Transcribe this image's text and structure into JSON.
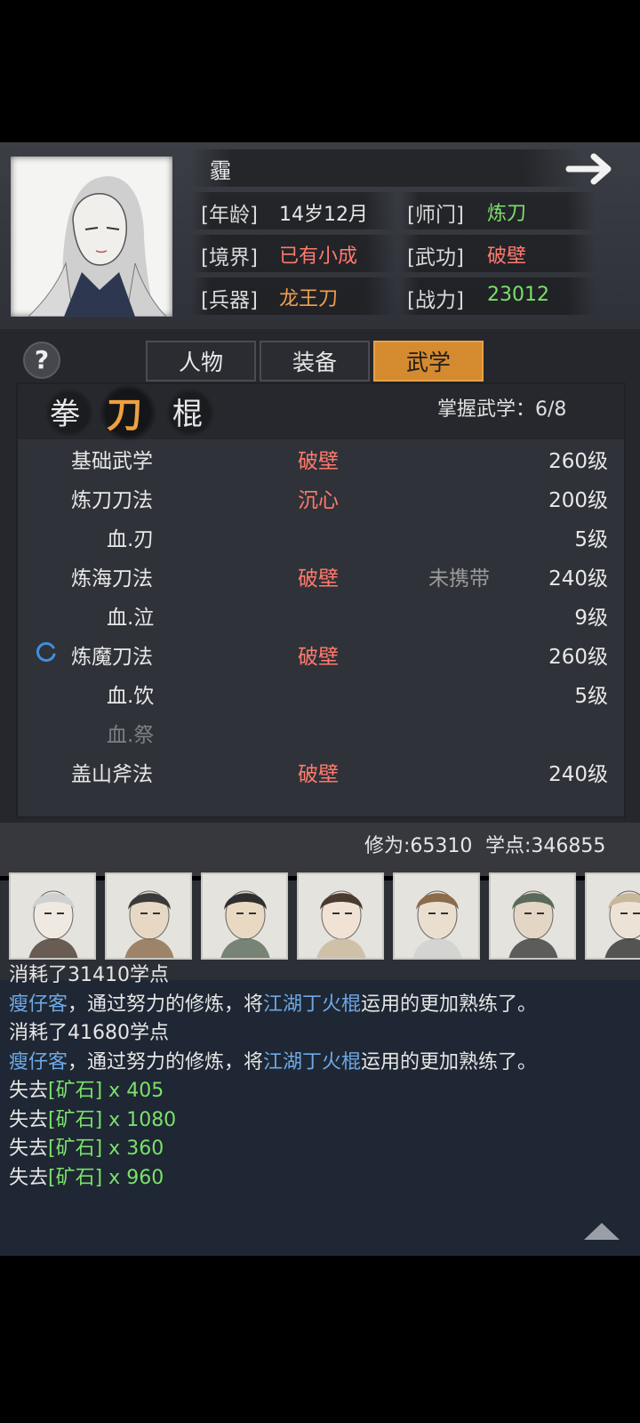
{
  "character": {
    "name": "霾",
    "age_label": "[年龄]",
    "age": "14岁12月",
    "sect_label": "[师门]",
    "sect": "炼刀",
    "realm_label": "[境界]",
    "realm": "已有小成",
    "skill_label": "[武功]",
    "skill": "破壁",
    "weapon_label": "[兵器]",
    "weapon": "龙王刀",
    "power_label": "[战力]",
    "power": "23012"
  },
  "help_glyph": "?",
  "tabs": [
    "人物",
    "装备",
    "武学"
  ],
  "active_tab": 2,
  "categories": [
    "拳",
    "刀",
    "棍"
  ],
  "active_category": 1,
  "mastery": "掌握武学：6/8",
  "skills": [
    {
      "name": "基础武学",
      "stage": "破壁",
      "carry": "",
      "level": "260级",
      "sub": false,
      "dim": false
    },
    {
      "name": "炼刀刀法",
      "stage": "沉心",
      "carry": "",
      "level": "200级",
      "sub": false,
      "dim": false
    },
    {
      "name": "血.刃",
      "stage": "",
      "carry": "",
      "level": "5级",
      "sub": true,
      "dim": false
    },
    {
      "name": "炼海刀法",
      "stage": "破壁",
      "carry": "未携带",
      "level": "240级",
      "sub": false,
      "dim": false
    },
    {
      "name": "血.泣",
      "stage": "",
      "carry": "",
      "level": "9级",
      "sub": true,
      "dim": false
    },
    {
      "name": "炼魔刀法",
      "stage": "破壁",
      "carry": "",
      "level": "260级",
      "sub": false,
      "dim": false
    },
    {
      "name": "血.饮",
      "stage": "",
      "carry": "",
      "level": "5级",
      "sub": true,
      "dim": false
    },
    {
      "name": "血.祭",
      "stage": "",
      "carry": "",
      "level": "",
      "sub": true,
      "dim": true
    },
    {
      "name": "盖山斧法",
      "stage": "破壁",
      "carry": "",
      "level": "240级",
      "sub": false,
      "dim": false
    }
  ],
  "stats": {
    "xiuwei": "修为:65310",
    "xuedian": "学点:346855"
  },
  "log": [
    [
      {
        "t": "消耗了31410学点",
        "c": "white"
      }
    ],
    [
      {
        "t": "瘦仔客",
        "c": "blue"
      },
      {
        "t": "，通过努力的修炼，将",
        "c": "white"
      },
      {
        "t": "江湖丁火棍",
        "c": "blue"
      },
      {
        "t": "运用的更加熟练了。",
        "c": "white"
      }
    ],
    [
      {
        "t": "消耗了41680学点",
        "c": "white"
      }
    ],
    [
      {
        "t": "瘦仔客",
        "c": "blue"
      },
      {
        "t": "，通过努力的修炼，将",
        "c": "white"
      },
      {
        "t": "江湖丁火棍",
        "c": "blue"
      },
      {
        "t": "运用的更加熟练了。",
        "c": "white"
      }
    ],
    [
      {
        "t": "失去",
        "c": "white"
      },
      {
        "t": "[矿石]",
        "c": "green"
      },
      {
        "t": " x 405",
        "c": "green"
      }
    ],
    [
      {
        "t": "失去",
        "c": "white"
      },
      {
        "t": "[矿石]",
        "c": "green"
      },
      {
        "t": " x 1080",
        "c": "green"
      }
    ],
    [
      {
        "t": "失去",
        "c": "white"
      },
      {
        "t": "[矿石]",
        "c": "green"
      },
      {
        "t": " x 360",
        "c": "green"
      }
    ],
    [
      {
        "t": "失去",
        "c": "white"
      },
      {
        "t": "[矿石]",
        "c": "green"
      },
      {
        "t": " x 960",
        "c": "green"
      }
    ]
  ],
  "icons": {
    "next": "arrow-right-icon",
    "help": "help-icon",
    "loading": "loading-icon",
    "collapse": "triangle-up-icon"
  },
  "colors": {
    "active_tab": "#d48a2e",
    "stage": "#ff7a6e",
    "sect": "#7be06a",
    "weapon": "#f0a050",
    "log_name": "#6fa8e6"
  }
}
